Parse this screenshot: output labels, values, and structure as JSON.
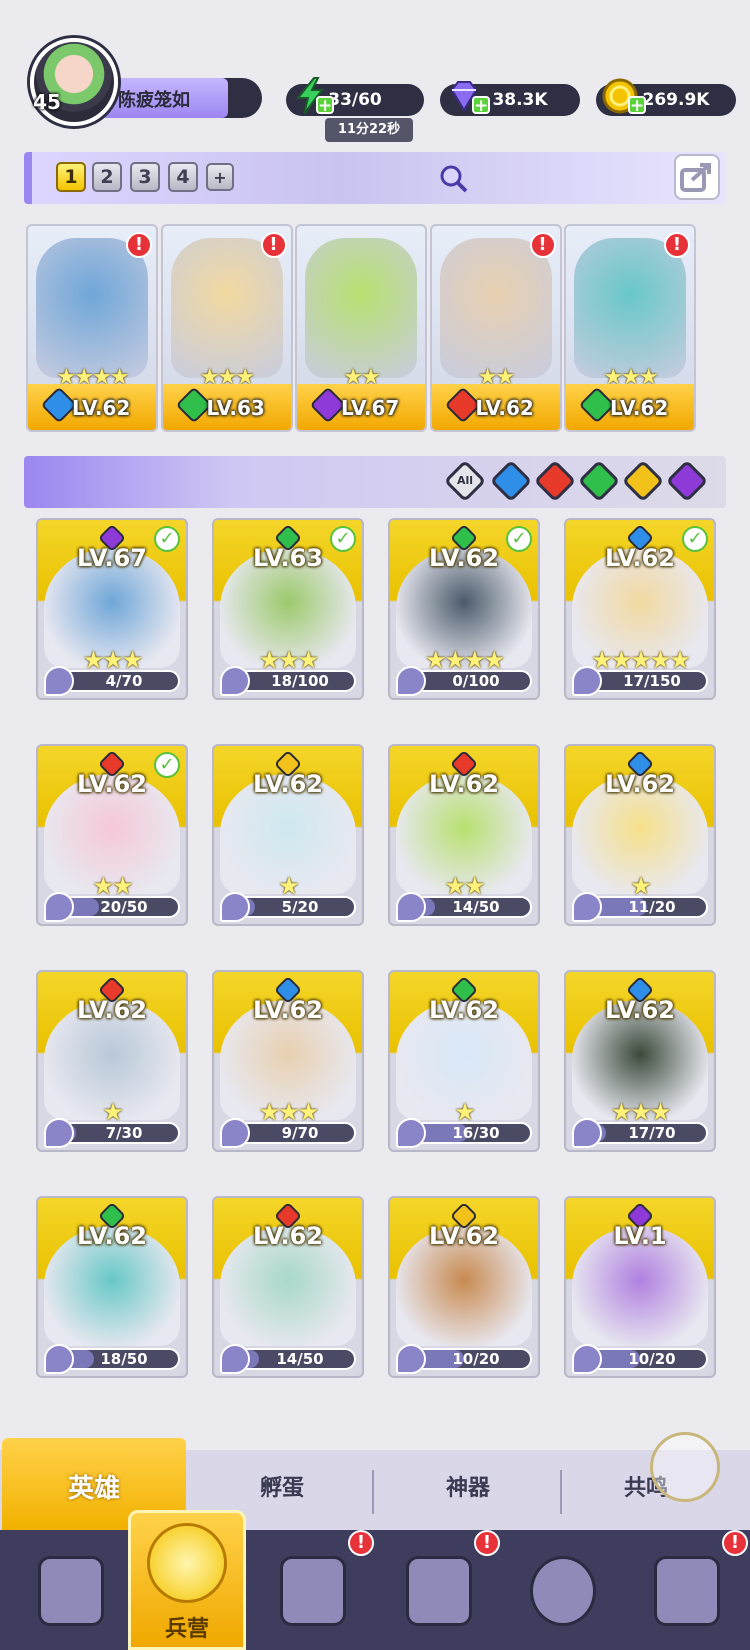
{
  "player": {
    "level": "45",
    "name": "陈疲笼如"
  },
  "resources": {
    "energy": {
      "value": "33/60",
      "timer": "11分22秒",
      "icon": "lightning-icon",
      "color": "#37d05a"
    },
    "gems": {
      "value": "38.3K",
      "icon": "diamond-icon",
      "color": "#8a6cf0"
    },
    "coins": {
      "value": "269.9K",
      "icon": "coin-icon",
      "color": "#f5c400"
    }
  },
  "team_slots": {
    "labels": [
      "1",
      "2",
      "3",
      "4",
      "+"
    ],
    "active": "1"
  },
  "team": [
    {
      "level": "LV.62",
      "element": "water",
      "stars": "★★★★",
      "alert": "!"
    },
    {
      "level": "LV.63",
      "element": "wind",
      "stars": "★★★",
      "alert": "!"
    },
    {
      "level": "LV.67",
      "element": "dark",
      "stars": "★★",
      "alert": ""
    },
    {
      "level": "LV.62",
      "element": "fire",
      "stars": "★★",
      "alert": "!"
    },
    {
      "level": "LV.62",
      "element": "wind",
      "stars": "★★★",
      "alert": "!"
    }
  ],
  "filters": {
    "all": "All",
    "elements": [
      "water",
      "fire",
      "wind",
      "light",
      "dark"
    ]
  },
  "element_colors": {
    "water": "#2f8fe8",
    "fire": "#e83a2a",
    "wind": "#2fbf4a",
    "light": "#f2c21a",
    "dark": "#8e3ad8"
  },
  "heroes": [
    {
      "level": "LV.67",
      "element": "dark",
      "fragments": "4/70",
      "progress": 0.06,
      "stars": "★★★",
      "check": true
    },
    {
      "level": "LV.63",
      "element": "wind",
      "fragments": "18/100",
      "progress": 0.18,
      "stars": "★★★",
      "check": true
    },
    {
      "level": "LV.62",
      "element": "wind",
      "fragments": "0/100",
      "progress": 0.0,
      "stars": "★★★★",
      "check": true
    },
    {
      "level": "LV.62",
      "element": "water",
      "fragments": "17/150",
      "progress": 0.11,
      "stars": "★★★★★",
      "check": true
    },
    {
      "level": "LV.62",
      "element": "fire",
      "fragments": "20/50",
      "progress": 0.4,
      "stars": "★★",
      "check": true
    },
    {
      "level": "LV.62",
      "element": "light",
      "fragments": "5/20",
      "progress": 0.25,
      "stars": "★",
      "check": false
    },
    {
      "level": "LV.62",
      "element": "fire",
      "fragments": "14/50",
      "progress": 0.28,
      "stars": "★★",
      "check": false
    },
    {
      "level": "LV.62",
      "element": "water",
      "fragments": "11/20",
      "progress": 0.55,
      "stars": "★",
      "check": false
    },
    {
      "level": "LV.62",
      "element": "fire",
      "fragments": "7/30",
      "progress": 0.23,
      "stars": "★",
      "check": false
    },
    {
      "level": "LV.62",
      "element": "water",
      "fragments": "9/70",
      "progress": 0.13,
      "stars": "★★★",
      "check": false
    },
    {
      "level": "LV.62",
      "element": "wind",
      "fragments": "16/30",
      "progress": 0.53,
      "stars": "★",
      "check": false
    },
    {
      "level": "LV.62",
      "element": "water",
      "fragments": "17/70",
      "progress": 0.24,
      "stars": "★★★",
      "check": false
    },
    {
      "level": "LV.62",
      "element": "wind",
      "fragments": "18/50",
      "progress": 0.36,
      "stars": "",
      "check": false
    },
    {
      "level": "LV.62",
      "element": "fire",
      "fragments": "14/50",
      "progress": 0.28,
      "stars": "",
      "check": false
    },
    {
      "level": "LV.62",
      "element": "light",
      "fragments": "10/20",
      "progress": 0.5,
      "stars": "",
      "check": false
    },
    {
      "level": "LV.1",
      "element": "dark",
      "fragments": "10/20",
      "progress": 0.5,
      "stars": "",
      "check": false
    }
  ],
  "tabs": [
    {
      "label": "英雄",
      "active": true
    },
    {
      "label": "孵蛋",
      "active": false
    },
    {
      "label": "神器",
      "active": false
    },
    {
      "label": "共鸣",
      "active": false
    }
  ],
  "nav": [
    {
      "icon": "cards-icon",
      "label": "",
      "alert": false
    },
    {
      "icon": "barracks-icon",
      "label": "兵营",
      "alert": false,
      "active": true
    },
    {
      "icon": "book-icon",
      "label": "",
      "alert": true
    },
    {
      "icon": "shrine-icon",
      "label": "",
      "alert": true
    },
    {
      "icon": "mushroom-icon",
      "label": "",
      "alert": false
    },
    {
      "icon": "guild-icon",
      "label": "",
      "alert": true
    }
  ]
}
